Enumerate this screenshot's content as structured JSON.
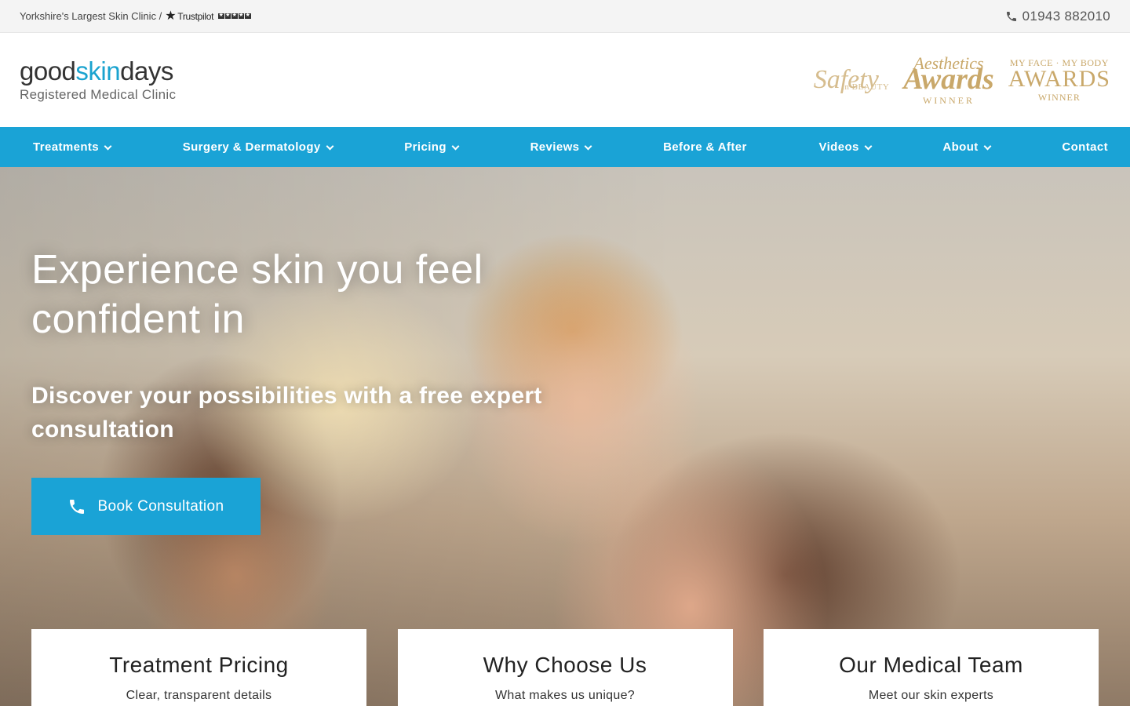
{
  "topbar": {
    "tagline": "Yorkshire's Largest Skin Clinic /",
    "trustpilot_label": "Trustpilot",
    "phone": "01943 882010"
  },
  "header": {
    "logo": {
      "good": "good",
      "skin": "skin",
      "days": "days",
      "subtitle": "Registered Medical Clinic"
    },
    "awards": {
      "safety": {
        "script": "Safety",
        "sub": "in BEAUTY"
      },
      "aesthetics": {
        "line1": "Aesthetics",
        "line2": "Awards",
        "line3": "WINNER"
      },
      "myface": {
        "line1": "MY FACE · MY BODY",
        "line2": "AWARDS",
        "line3": "WINNER"
      }
    }
  },
  "nav": {
    "items": [
      {
        "label": "Treatments"
      },
      {
        "label": "Surgery & Dermatology"
      },
      {
        "label": "Pricing"
      },
      {
        "label": "Reviews"
      },
      {
        "label": "Before & After"
      },
      {
        "label": "Videos"
      },
      {
        "label": "About"
      },
      {
        "label": "Contact"
      }
    ]
  },
  "hero": {
    "title": "Experience skin you feel confident in",
    "subtitle": "Discover your possibilities with a free expert consultation",
    "cta_label": "Book Consultation"
  },
  "cards": [
    {
      "title": "Treatment Pricing",
      "subtitle": "Clear, transparent details"
    },
    {
      "title": "Why Choose Us",
      "subtitle": "What makes us unique?"
    },
    {
      "title": "Our Medical Team",
      "subtitle": "Meet our skin experts"
    }
  ],
  "colors": {
    "brand_blue": "#1aa3d6",
    "gold": "#c9a86a"
  }
}
